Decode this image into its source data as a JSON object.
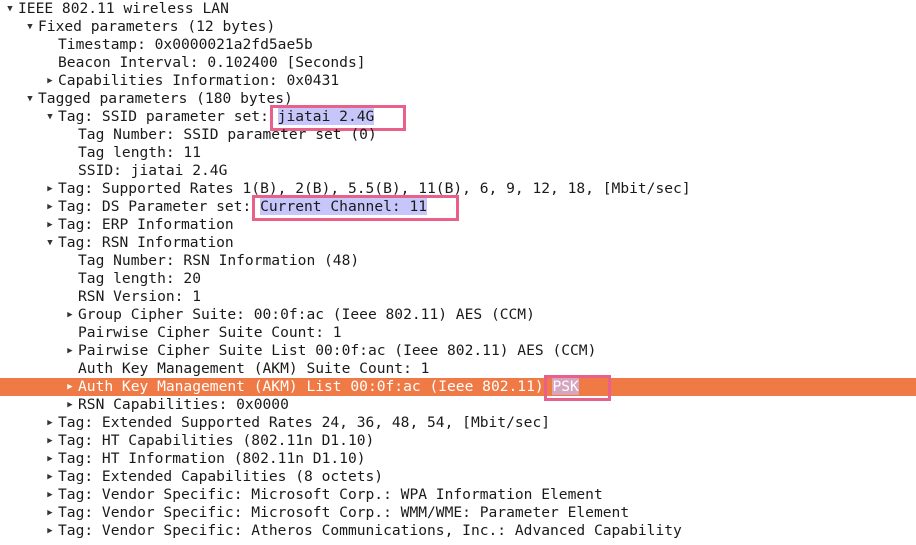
{
  "tree": [
    {
      "depth": 0,
      "toggle": "open",
      "label": "IEEE 802.11 wireless LAN"
    },
    {
      "depth": 1,
      "toggle": "open",
      "label": "Fixed parameters (12 bytes)"
    },
    {
      "depth": 2,
      "toggle": "none",
      "label": "Timestamp: 0x0000021a2fd5ae5b"
    },
    {
      "depth": 2,
      "toggle": "none",
      "label": "Beacon Interval: 0.102400 [Seconds]"
    },
    {
      "depth": 2,
      "toggle": "closed",
      "label": "Capabilities Information: 0x0431"
    },
    {
      "depth": 1,
      "toggle": "open",
      "label": "Tagged parameters (180 bytes)"
    },
    {
      "depth": 2,
      "toggle": "open",
      "label": "Tag: SSID parameter set: ",
      "value": "jiatai 2.4G",
      "highlight": true
    },
    {
      "depth": 3,
      "toggle": "none",
      "label": "Tag Number: SSID parameter set (0)"
    },
    {
      "depth": 3,
      "toggle": "none",
      "label": "Tag length: 11"
    },
    {
      "depth": 3,
      "toggle": "none",
      "label": "SSID: jiatai 2.4G"
    },
    {
      "depth": 2,
      "toggle": "closed",
      "label": "Tag: Supported Rates 1(B), 2(B), 5.5(B), 11(B), 6, 9, 12, 18, [Mbit/sec]"
    },
    {
      "depth": 2,
      "toggle": "closed",
      "label": "Tag: DS Parameter set: ",
      "value": "Current Channel: 11",
      "highlight": true
    },
    {
      "depth": 2,
      "toggle": "closed",
      "label": "Tag: ERP Information"
    },
    {
      "depth": 2,
      "toggle": "open",
      "label": "Tag: RSN Information"
    },
    {
      "depth": 3,
      "toggle": "none",
      "label": "Tag Number: RSN Information (48)"
    },
    {
      "depth": 3,
      "toggle": "none",
      "label": "Tag length: 20"
    },
    {
      "depth": 3,
      "toggle": "none",
      "label": "RSN Version: 1"
    },
    {
      "depth": 3,
      "toggle": "closed",
      "label": "Group Cipher Suite: 00:0f:ac (Ieee 802.11) AES (CCM)"
    },
    {
      "depth": 3,
      "toggle": "none",
      "label": "Pairwise Cipher Suite Count: 1"
    },
    {
      "depth": 3,
      "toggle": "closed",
      "label": "Pairwise Cipher Suite List 00:0f:ac (Ieee 802.11) AES (CCM)"
    },
    {
      "depth": 3,
      "toggle": "none",
      "label": "Auth Key Management (AKM) Suite Count: 1"
    },
    {
      "depth": 3,
      "toggle": "closed",
      "label": "Auth Key Management (AKM) List 00:0f:ac (Ieee 802.11) ",
      "value": "PSK",
      "highlight": true,
      "selected": true
    },
    {
      "depth": 3,
      "toggle": "closed",
      "label": "RSN Capabilities: 0x0000"
    },
    {
      "depth": 2,
      "toggle": "closed",
      "label": "Tag: Extended Supported Rates 24, 36, 48, 54, [Mbit/sec]"
    },
    {
      "depth": 2,
      "toggle": "closed",
      "label": "Tag: HT Capabilities (802.11n D1.10)"
    },
    {
      "depth": 2,
      "toggle": "closed",
      "label": "Tag: HT Information (802.11n D1.10)"
    },
    {
      "depth": 2,
      "toggle": "closed",
      "label": "Tag: Extended Capabilities (8 octets)"
    },
    {
      "depth": 2,
      "toggle": "closed",
      "label": "Tag: Vendor Specific: Microsoft Corp.: WPA Information Element"
    },
    {
      "depth": 2,
      "toggle": "closed",
      "label": "Tag: Vendor Specific: Microsoft Corp.: WMM/WME: Parameter Element"
    },
    {
      "depth": 2,
      "toggle": "closed",
      "label": "Tag: Vendor Specific: Atheros Communications, Inc.: Advanced Capability"
    }
  ],
  "colors": {
    "selected_row": "#ef7a45",
    "value_highlight": "#c7c6fa",
    "annotation_box": "#e8618a"
  }
}
